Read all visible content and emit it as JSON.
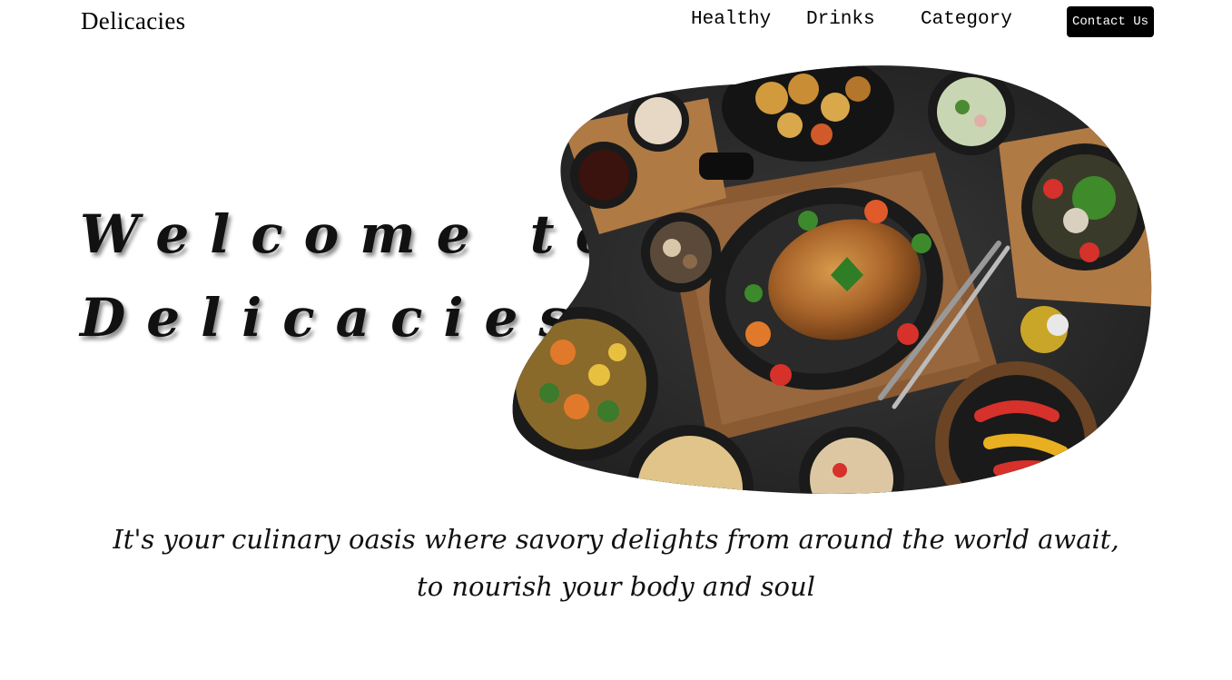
{
  "brand": {
    "name": "Delicacies"
  },
  "nav": {
    "links": [
      {
        "label": "Healthy"
      },
      {
        "label": "Drinks"
      },
      {
        "label": "Category"
      }
    ],
    "contact_label": "Contact Us"
  },
  "hero": {
    "headline_line1": "Welcome to",
    "headline_line2": "Delicacies",
    "image_icon": "food-spread-image",
    "tagline_line1": "It's your culinary oasis where savory delights from around the world await,",
    "tagline_line2": "to nourish your body and soul"
  },
  "colors": {
    "background": "#ffffff",
    "text": "#000000",
    "button_bg": "#000000",
    "button_text": "#ffffff"
  }
}
